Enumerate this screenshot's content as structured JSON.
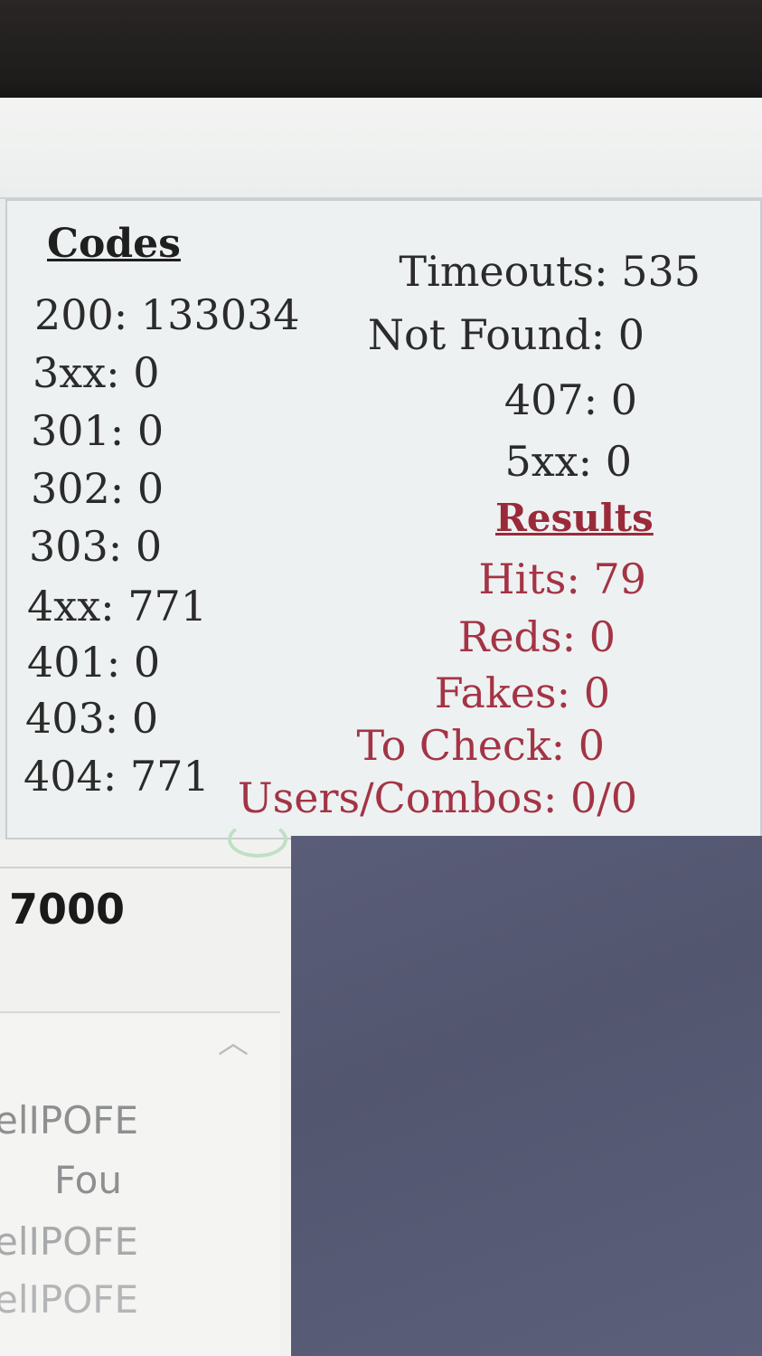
{
  "codes": {
    "heading": "Codes",
    "items": [
      {
        "label": "200: 133034"
      },
      {
        "label": "3xx: 0"
      },
      {
        "label": "301: 0"
      },
      {
        "label": "302: 0"
      },
      {
        "label": "303: 0"
      },
      {
        "label": "4xx: 771"
      },
      {
        "label": "401: 0"
      },
      {
        "label": "403: 0"
      },
      {
        "label": "404: 771"
      }
    ]
  },
  "errors": {
    "timeouts": "Timeouts: 535",
    "not_found": "Not Found: 0",
    "code_407": "407: 0",
    "code_5xx": "5xx: 0"
  },
  "results": {
    "heading": "Results",
    "hits": "Hits: 79",
    "reds": "Reds: 0",
    "fakes": "Fakes: 0",
    "to_check": "To Check: 0",
    "users_combos": "Users/Combos: 0/0"
  },
  "lower": {
    "value": "7000",
    "list_items": [
      "elIPOFE",
      "Fou",
      "elIPOFE",
      "elIPOFE"
    ]
  },
  "colors": {
    "results_accent": "#a33445",
    "panel_bg": "#eef1f1",
    "dark_area": "#565a74"
  }
}
